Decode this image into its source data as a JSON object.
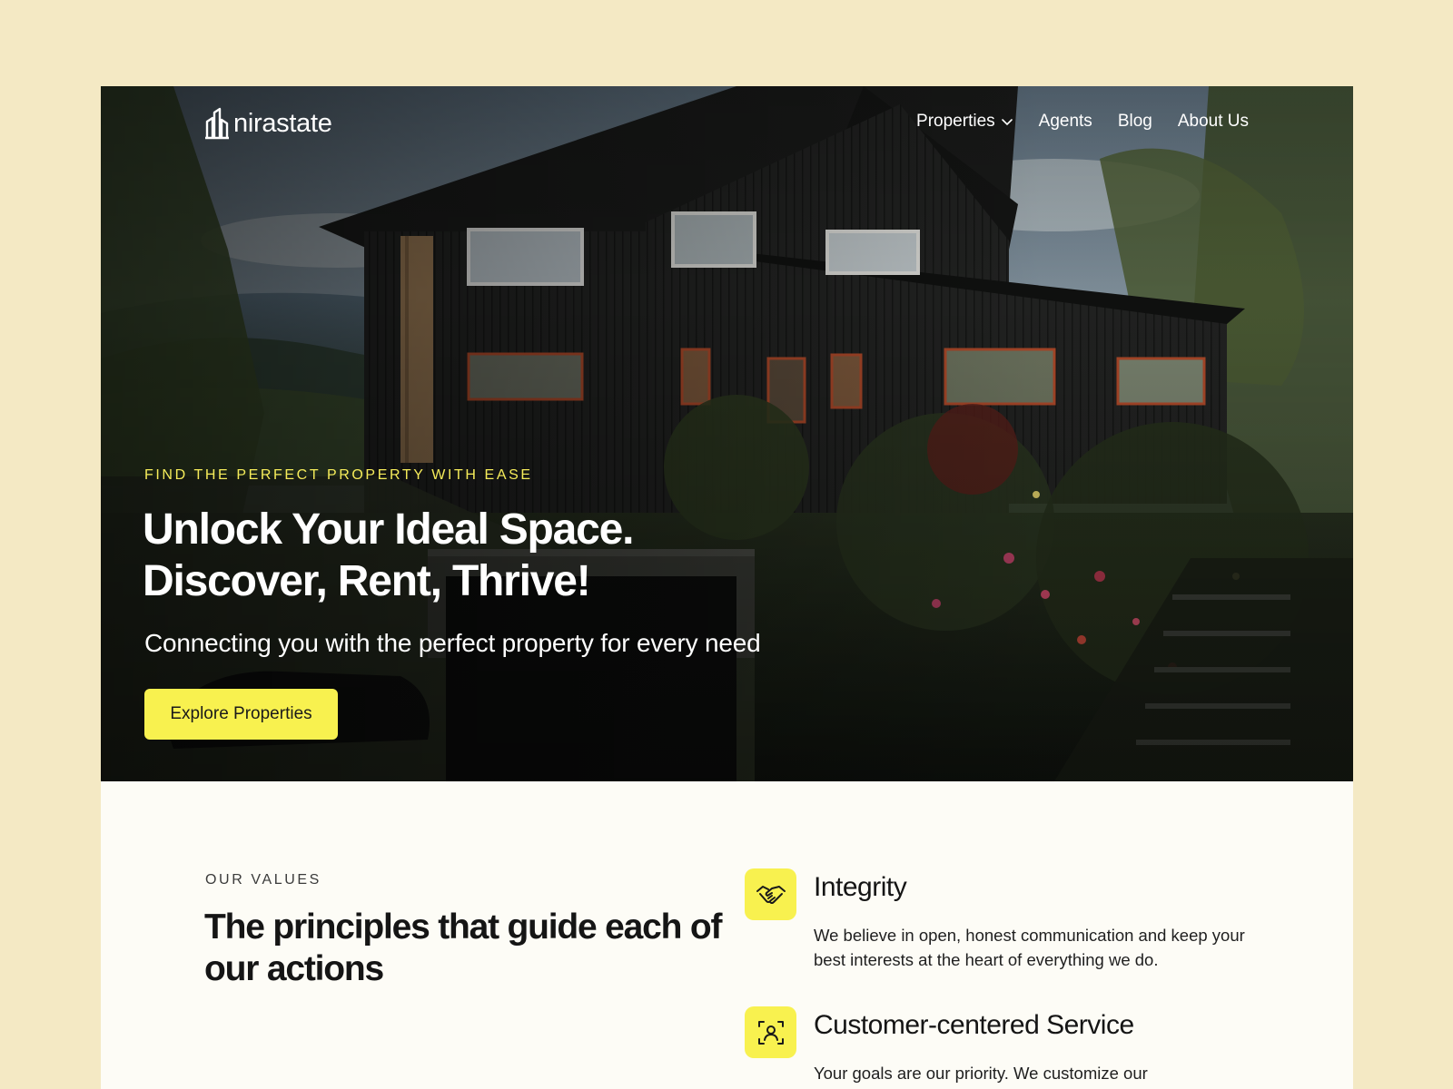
{
  "brand": {
    "name": "nirastate"
  },
  "nav": {
    "items": [
      {
        "label": "Properties",
        "has_dropdown": true
      },
      {
        "label": "Agents"
      },
      {
        "label": "Blog"
      },
      {
        "label": "About Us"
      }
    ]
  },
  "hero": {
    "eyebrow": "FIND THE PERFECT PROPERTY WITH EASE",
    "headline_line1": "Unlock Your Ideal Space.",
    "headline_line2": "Discover, Rent, Thrive!",
    "subline": "Connecting you with the perfect property for every need",
    "cta_label": "Explore Properties"
  },
  "values": {
    "eyebrow": "OUR VALUES",
    "title": "The principles that guide each of our actions",
    "items": [
      {
        "icon": "handshake-icon",
        "title": "Integrity",
        "description": "We believe in open, honest communication and keep your best interests at the heart of everything we do."
      },
      {
        "icon": "customer-focus-icon",
        "title": "Customer-centered Service",
        "description": "Your goals are our priority. We customize our"
      }
    ]
  },
  "colors": {
    "page_bg": "#f4e9c4",
    "accent_yellow": "#f8f14f",
    "eyebrow_yellow": "#f6ec5a",
    "content_bg": "#fdfcf6"
  }
}
